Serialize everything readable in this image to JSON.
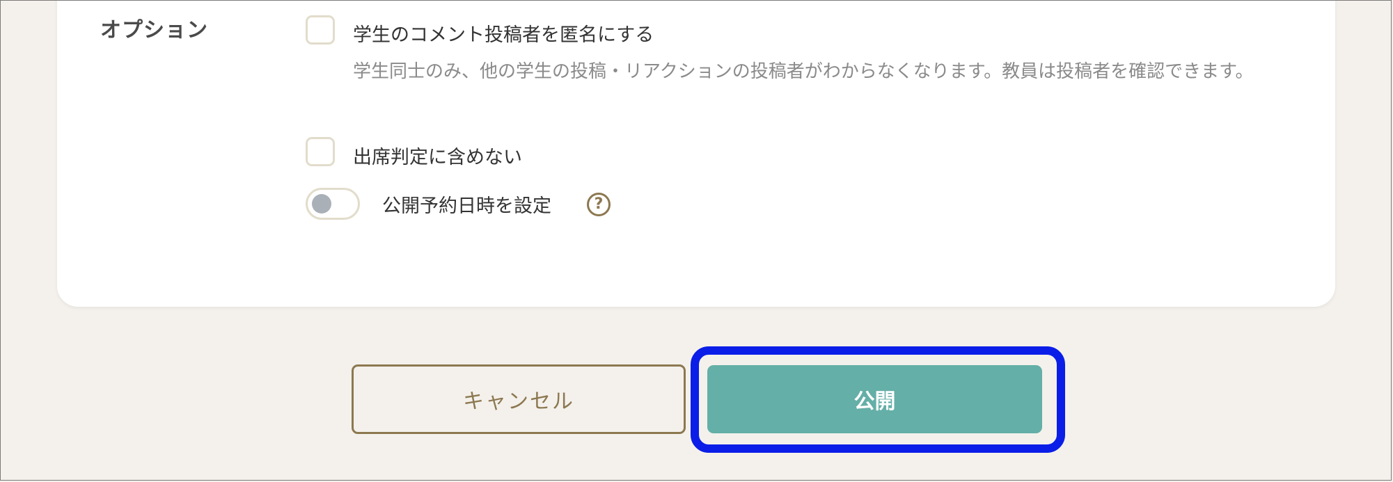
{
  "options": {
    "section_label": "オプション",
    "anonymous": {
      "label": "学生のコメント投稿者を匿名にする",
      "description": "学生同士のみ、他の学生の投稿・リアクションの投稿者がわからなくなります。教員は投稿者を確認できます。",
      "checked": false
    },
    "exclude_attendance": {
      "label": "出席判定に含めない",
      "checked": false
    },
    "schedule": {
      "label": "公開予約日時を設定",
      "enabled": false,
      "help_icon": "question-circle-icon",
      "help_glyph": "?"
    }
  },
  "actions": {
    "cancel_label": "キャンセル",
    "publish_label": "公開"
  },
  "colors": {
    "page_background": "#f4f1ec",
    "card_background": "#ffffff",
    "accent_brown": "#8c7850",
    "publish_teal": "#64afa7",
    "focus_ring_blue": "#0a1ee8",
    "checkbox_border": "#e2dccb",
    "toggle_knob_gray": "#aab0b8"
  }
}
